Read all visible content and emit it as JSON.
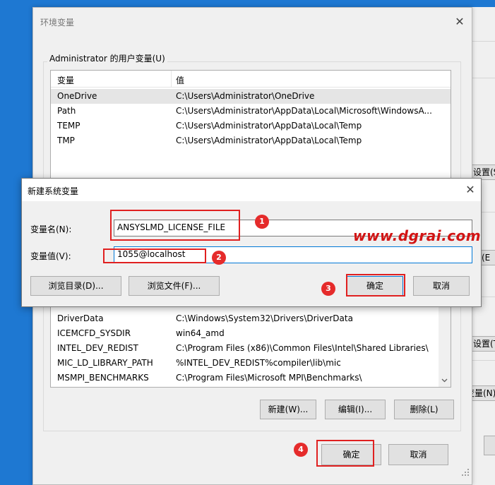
{
  "background_window": {
    "buttons": [
      "设置(S",
      "置(E",
      "设置(T",
      "变量(N)"
    ]
  },
  "env_dialog": {
    "title": "环境变量",
    "close_glyph": "✕",
    "user_group_label": "Administrator 的用户变量(U)",
    "columns": [
      "变量",
      "值"
    ],
    "user_vars": [
      {
        "name": "OneDrive",
        "value": "C:\\Users\\Administrator\\OneDrive"
      },
      {
        "name": "Path",
        "value": "C:\\Users\\Administrator\\AppData\\Local\\Microsoft\\WindowsA..."
      },
      {
        "name": "TEMP",
        "value": "C:\\Users\\Administrator\\AppData\\Local\\Temp"
      },
      {
        "name": "TMP",
        "value": "C:\\Users\\Administrator\\AppData\\Local\\Temp"
      }
    ],
    "system_vars": [
      {
        "name": "DriverData",
        "value": "C:\\Windows\\System32\\Drivers\\DriverData"
      },
      {
        "name": "ICEMCFD_SYSDIR",
        "value": "win64_amd"
      },
      {
        "name": "INTEL_DEV_REDIST",
        "value": "C:\\Program Files (x86)\\Common Files\\Intel\\Shared Libraries\\"
      },
      {
        "name": "MIC_LD_LIBRARY_PATH",
        "value": "%INTEL_DEV_REDIST%compiler\\lib\\mic"
      },
      {
        "name": "MSMPI_BENCHMARKS",
        "value": "C:\\Program Files\\Microsoft MPI\\Benchmarks\\"
      }
    ],
    "system_buttons": {
      "new": "新建(W)...",
      "edit": "编辑(I)...",
      "delete": "删除(L)"
    },
    "ok": "确定",
    "cancel": "取消"
  },
  "new_var_dialog": {
    "title": "新建系统变量",
    "close_glyph": "✕",
    "name_label": "变量名(N):",
    "name_value": "ANSYSLMD_LICENSE_FILE",
    "value_label": "变量值(V):",
    "value_value": "1055@localhost",
    "browse_dir": "浏览目录(D)...",
    "browse_file": "浏览文件(F)...",
    "ok": "确定",
    "cancel": "取消"
  },
  "annotations": {
    "steps": [
      "1",
      "2",
      "3",
      "4"
    ],
    "accent_color": "#e02020",
    "watermark": "www.dgrai.com"
  }
}
